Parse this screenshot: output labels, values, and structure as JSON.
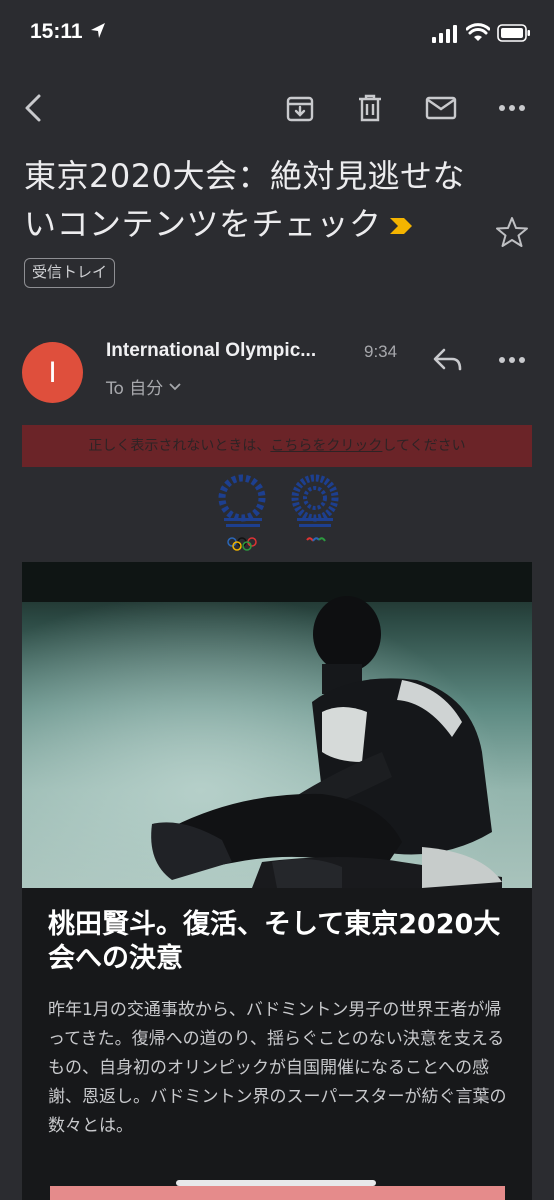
{
  "status": {
    "time": "15:11"
  },
  "toolbar": {
    "back_icon": "back-arrow-icon",
    "archive_icon": "archive-icon",
    "delete_icon": "trash-icon",
    "mark_unread_icon": "mail-icon",
    "more_icon": "more-horizontal-icon"
  },
  "email": {
    "subject": "東京2020大会：絶対見逃せないコンテンツをチェック",
    "label": "受信トレイ",
    "sender": {
      "initial": "I",
      "name": "International Olympic...",
      "time": "9:34",
      "recipient": "To 自分"
    },
    "body": {
      "notice_prefix": "正しく表示されないときは、",
      "notice_link": "こちらをクリック",
      "notice_suffix": "してください",
      "headline": "桃田賢斗。復活、そして東京2020大会への決意",
      "text": "昨年1月の交通事故から、バドミントン男子の世界王者が帰ってきた。復帰への道のり、揺らぐことのない決意を支えるもの、自身初のオリンピックが自国開催になることへの感謝、恩返し。バドミントン界のスーパースターが紡ぐ言葉の数々とは。"
    }
  },
  "colors": {
    "background": "#2b2c30",
    "avatar": "#df4f3c",
    "important": "#f4b400",
    "notice_bar": "#6b2428",
    "cta": "#e58b8b"
  }
}
